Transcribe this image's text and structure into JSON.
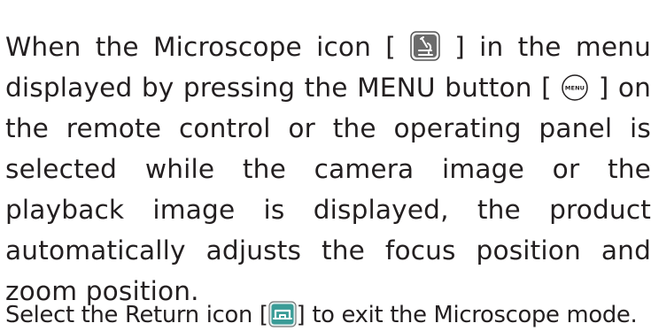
{
  "para1": {
    "s1": "When the Microscope icon [",
    "s2": "] in the menu displayed by pressing the MENU button [",
    "s3": "] on the remote control or the operating panel is selected while the camera image or the playback image is displayed, the product automatically adjusts the focus position and zoom position."
  },
  "para2": {
    "s1": "Select the Return icon [",
    "s2": "] to exit the Microscope mode."
  },
  "icons": {
    "microscope": "microscope-icon",
    "menu_button": "menu-button-icon",
    "menu_button_text": "MENU",
    "return": "return-icon"
  },
  "colors": {
    "text": "#231f20",
    "microscope_icon_bg": "#6b6b6b",
    "return_icon_bg": "#3a9c97"
  }
}
